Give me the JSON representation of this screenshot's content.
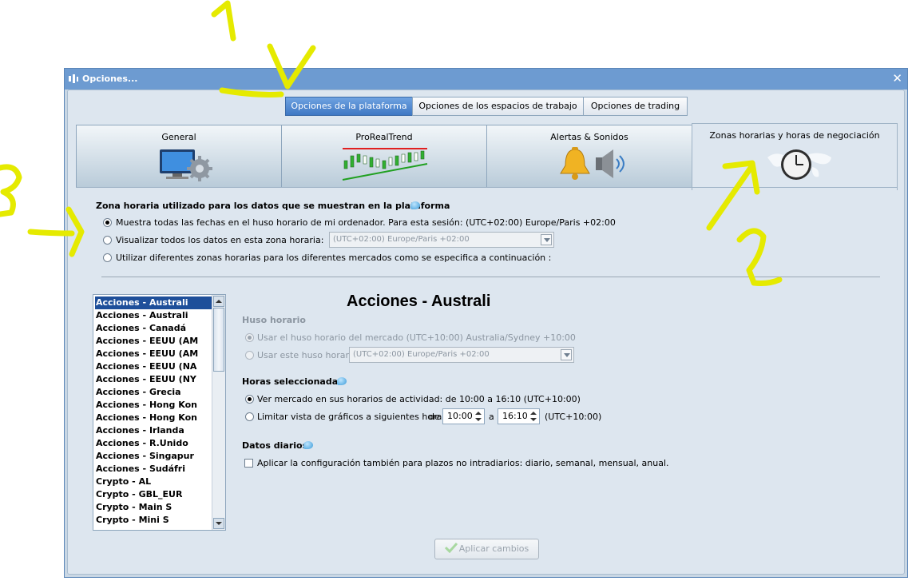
{
  "window": {
    "title": "Opciones...",
    "close_glyph": "✕"
  },
  "top_tabs": [
    {
      "label": "Opciones de la plataforma",
      "active": true
    },
    {
      "label": "Opciones de los espacios de trabajo",
      "active": false
    },
    {
      "label": "Opciones de trading",
      "active": false
    }
  ],
  "icon_tabs": [
    {
      "label": "General",
      "icon": "monitor-gear-icon",
      "active": false
    },
    {
      "label": "ProRealTrend",
      "icon": "trend-chart-icon",
      "active": false
    },
    {
      "label": "Alertas & Sonidos",
      "icon": "bell-speaker-icon",
      "active": false
    },
    {
      "label": "Zonas horarias y horas de negociación",
      "icon": "world-clock-icon",
      "active": true
    }
  ],
  "timezone_section": {
    "heading": "Zona horaria utilizado para los datos que se muestran en la plataforma",
    "options": [
      {
        "label": "Muestra todas las fechas en el huso horario de mi ordenador. Para esta sesión: (UTC+02:00) Europe/Paris +02:00",
        "selected": true
      },
      {
        "label": "Visualizar todos los datos en esta zona horaria:",
        "selected": false
      },
      {
        "label": "Utilizar diferentes zonas horarias para los diferentes mercados como se especifica a continuación :",
        "selected": false
      }
    ],
    "zone_select_value": "(UTC+02:00) Europe/Paris +02:00"
  },
  "market_list": {
    "items": [
      "Acciones - Australi",
      "Acciones - Australi",
      "Acciones - Canadá",
      "Acciones - EEUU (AM",
      "Acciones - EEUU (AM",
      "Acciones - EEUU (NA",
      "Acciones - EEUU (NY",
      "Acciones - Grecia",
      "Acciones - Hong Kon",
      "Acciones - Hong Kon",
      "Acciones - Irlanda",
      "Acciones - R.Unido",
      "Acciones - Singapur",
      "Acciones - Sudáfri",
      "Crypto - AL",
      "Crypto - GBL_EUR",
      "Crypto - Main S",
      "Crypto - Mini S"
    ],
    "selected_index": 0
  },
  "detail": {
    "title": "Acciones - Australi",
    "huso_heading": "Huso horario",
    "huso_options": [
      {
        "label": "Usar el huso horario del mercado (UTC+10:00) Australia/Sydney +10:00",
        "selected": true
      },
      {
        "label": "Usar este huso horario:",
        "selected": false
      }
    ],
    "huso_select_value": "(UTC+02:00) Europe/Paris +02:00",
    "horas_heading": "Horas seleccionadas",
    "horas_options": [
      {
        "label": "Ver mercado en sus horarios de actividad: de 10:00 a 16:10  (UTC+10:00)",
        "selected": true
      },
      {
        "label": "Limitar vista de gráficos a siguientes horas",
        "selected": false
      }
    ],
    "de_label": "de",
    "from_time": "10:00",
    "a_label": "a",
    "to_time": "16:10",
    "tz_suffix": "(UTC+10:00)",
    "daily_heading": "Datos diarios",
    "daily_checkbox_label": "Aplicar la configuración también para plazos no intradiarios: diario, semanal, mensual, anual.",
    "daily_checked": false
  },
  "apply_button": {
    "label": "Aplicar cambios",
    "enabled": false
  },
  "colors": {
    "active_tab": "#4a84cf",
    "titlebar": "#6d9bd1",
    "panel_bg": "#dde6ef",
    "selected_list_item": "#1e4f9a",
    "annotation": "#e5ea00"
  }
}
